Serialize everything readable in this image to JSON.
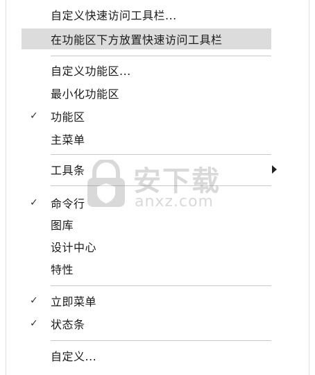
{
  "menu": {
    "items": [
      {
        "label": "自定义快速访问工具栏...",
        "checked": false,
        "highlighted": false
      },
      {
        "label": "在功能区下方放置快速访问工具栏",
        "checked": false,
        "highlighted": true
      },
      {
        "label": "自定义功能区...",
        "checked": false,
        "highlighted": false
      },
      {
        "label": "最小化功能区",
        "checked": false,
        "highlighted": false
      },
      {
        "label": "功能区",
        "checked": true,
        "highlighted": false
      },
      {
        "label": "主菜单",
        "checked": false,
        "highlighted": false
      },
      {
        "label": "工具条",
        "checked": false,
        "highlighted": false,
        "submenu": true
      },
      {
        "label": "命令行",
        "checked": true,
        "highlighted": false
      },
      {
        "label": "图库",
        "checked": false,
        "highlighted": false
      },
      {
        "label": "设计中心",
        "checked": false,
        "highlighted": false
      },
      {
        "label": "特性",
        "checked": false,
        "highlighted": false
      },
      {
        "label": "立即菜单",
        "checked": true,
        "highlighted": false
      },
      {
        "label": "状态条",
        "checked": true,
        "highlighted": false
      },
      {
        "label": "自定义...",
        "checked": false,
        "highlighted": false
      }
    ],
    "check_glyph": "✓",
    "submenu_icon": "triangle-right-icon"
  },
  "watermark": {
    "cn": "安下载",
    "en": "anxz.com",
    "icon": "shield-lock-icon"
  }
}
